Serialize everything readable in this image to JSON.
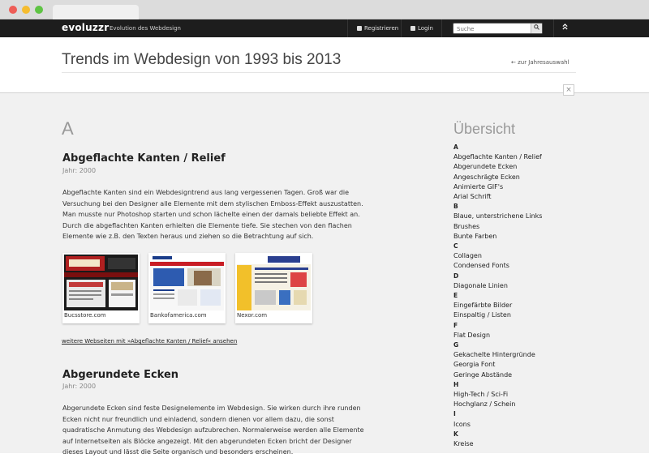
{
  "nav": {
    "logo": "evoluzzr",
    "tagline": "Evolution des Webdesign",
    "register": "Registrieren",
    "login": "Login",
    "search_placeholder": "Suche"
  },
  "header": {
    "title": "Trends im Webdesign von 1993 bis 2013",
    "back_link": "← zur Jahresauswahl"
  },
  "main": {
    "section_letter": "A",
    "entries": [
      {
        "title": "Abgeflachte Kanten / Relief",
        "year": "Jahr: 2000",
        "text": "Abgeflachte Kanten sind ein Webdesigntrend aus lang vergessenen Tagen. Groß war die Versuchung bei den Designer alle Elemente mit dem stylischen Emboss-Effekt auszustatten. Man musste nur Photoshop starten und schon lächelte einen der damals beliebte Effekt an. Durch die abgeflachten Kanten erhielten die Elemente tiefe. Sie stechen von den flachen Elemente wie z.B. den Texten heraus und ziehen so die Betrachtung auf sich.",
        "examples": [
          "Bucsstore.com",
          "Bankofamerica.com",
          "Nexor.com"
        ],
        "more_link": "weitere Webseiten mit »Abgeflachte Kanten / Relief« ansehen"
      },
      {
        "title": "Abgerundete Ecken",
        "year": "Jahr: 2000",
        "text": "Abgerundete Ecken sind feste Designelemente im Webdesign. Sie wirken durch ihre runden Ecken nicht nur freundlich und einladend, sondern dienen vor allem dazu, die sonst quadratische Anmutung des Webdesign aufzubrechen. Normalerweise werden alle Elemente auf Internetseiten als Blöcke angezeigt. Mit den abgerundeten Ecken bricht der Designer dieses Layout und lässt die Seite organisch und besonders erscheinen."
      }
    ]
  },
  "sidebar": {
    "title": "Übersicht",
    "groups": [
      {
        "letter": "A",
        "items": [
          "Abgeflachte Kanten / Relief",
          "Abgerundete Ecken",
          "Angeschrägte Ecken",
          "Animierte GIF's",
          "Arial Schrift"
        ]
      },
      {
        "letter": "B",
        "items": [
          "Blaue, unterstrichene Links",
          "Brushes",
          "Bunte Farben"
        ]
      },
      {
        "letter": "C",
        "items": [
          "Collagen",
          "Condensed Fonts"
        ]
      },
      {
        "letter": "D",
        "items": [
          "Diagonale Linien"
        ]
      },
      {
        "letter": "E",
        "items": [
          "Eingefärbte Bilder",
          "Einspaltig / Listen"
        ]
      },
      {
        "letter": "F",
        "items": [
          "Flat Design"
        ]
      },
      {
        "letter": "G",
        "items": [
          "Gekachelte Hintergründe",
          "Georgia Font",
          "Geringe Abstände"
        ]
      },
      {
        "letter": "H",
        "items": [
          "High-Tech / Sci-Fi",
          "Hochglanz / Schein"
        ]
      },
      {
        "letter": "I",
        "items": [
          "Icons"
        ]
      },
      {
        "letter": "K",
        "items": [
          "Kreise"
        ]
      }
    ]
  }
}
